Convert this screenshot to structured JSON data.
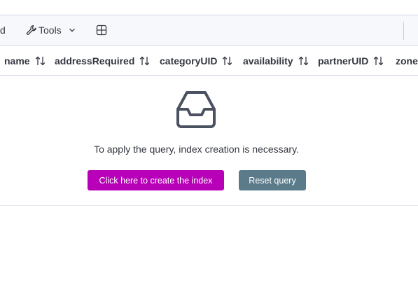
{
  "toolbar": {
    "cut_label": "d",
    "tools_label": "Tools",
    "tools_icon": "wrench-icon",
    "grid_icon": "grid-icon"
  },
  "columns": [
    {
      "label": "name"
    },
    {
      "label": "addressRequired"
    },
    {
      "label": "categoryUID"
    },
    {
      "label": "availability"
    },
    {
      "label": "partnerUID"
    },
    {
      "label": "zone"
    }
  ],
  "empty_state": {
    "icon": "inbox-icon",
    "message": "To apply the query, index creation is necessary.",
    "create_button": "Click here to create the index",
    "reset_button": "Reset query"
  },
  "colors": {
    "primary_button": "#b700b8",
    "secondary_button": "#5b7b8a",
    "toolbar_bg": "#f7f8fc"
  }
}
